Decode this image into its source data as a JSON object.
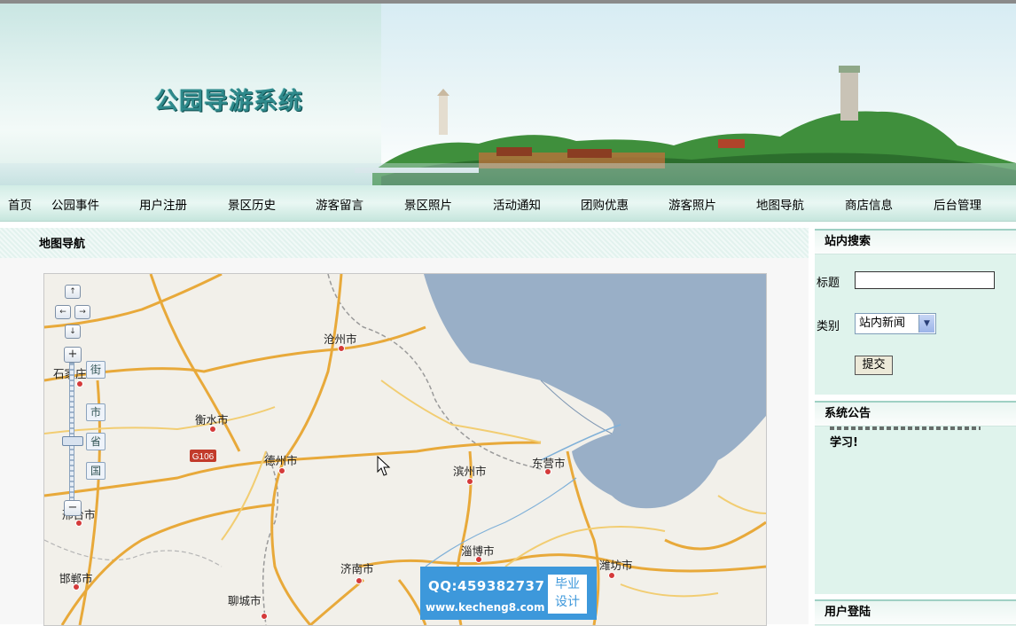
{
  "site": {
    "title": "公园导游系统"
  },
  "nav": {
    "items": [
      "首页",
      "公园事件",
      "用户注册",
      "景区历史",
      "游客留言",
      "景区照片",
      "活动通知",
      "团购优惠",
      "游客照片",
      "地图导航",
      "商店信息",
      "后台管理"
    ]
  },
  "main": {
    "heading": "地图导航"
  },
  "map": {
    "cities": [
      "沧州市",
      "石家庄",
      "衡水市",
      "德州市",
      "滨州市",
      "东营市",
      "邢台市",
      "淄博市",
      "济南市",
      "潍坊市",
      "邯郸市",
      "聊城市"
    ],
    "road_label": "G106",
    "layer_tabs": [
      "街",
      "市",
      "省",
      "国"
    ],
    "pan_controls": [
      "↑",
      "←",
      "→",
      "↓"
    ],
    "zoom_in": "+",
    "zoom_out": "−"
  },
  "sidebar": {
    "search": {
      "title": "站内搜索",
      "title_label": "标题",
      "title_value": "",
      "category_label": "类别",
      "category_value": "站内新闻",
      "submit_label": "提交"
    },
    "notice": {
      "title": "系统公告",
      "text": "学习!"
    },
    "login": {
      "title": "用户登陆"
    }
  },
  "watermark": {
    "qq": "QQ:459382737",
    "site": "www.kecheng8.com",
    "badge_top": "毕业",
    "badge_bottom": "设计"
  }
}
